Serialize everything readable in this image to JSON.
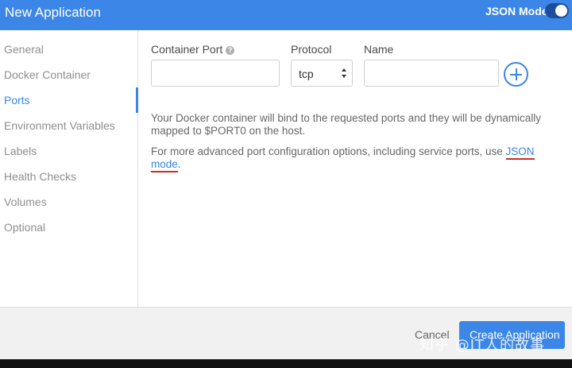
{
  "header": {
    "title": "New Application",
    "json_mode_label": "JSON Mode",
    "json_mode_on": true
  },
  "sidebar": {
    "items": [
      {
        "label": "General"
      },
      {
        "label": "Docker Container"
      },
      {
        "label": "Ports",
        "active": true
      },
      {
        "label": "Environment Variables"
      },
      {
        "label": "Labels"
      },
      {
        "label": "Health Checks"
      },
      {
        "label": "Volumes"
      },
      {
        "label": "Optional"
      }
    ]
  },
  "ports": {
    "container_port_label": "Container Port",
    "container_port_value": "",
    "protocol_label": "Protocol",
    "protocol_value": "tcp",
    "name_label": "Name",
    "name_value": ""
  },
  "help": {
    "line1": "Your Docker container will bind to the requested ports and they will be dynamically mapped to $PORT0 on the host.",
    "line2_prefix": "For more advanced port configuration options, including service ports, use ",
    "line2_link": "JSON mode",
    "line2_suffix": "."
  },
  "footer": {
    "cancel_label": "Cancel",
    "create_label": "Create Application"
  },
  "watermark": "知乎 @IT人的故事",
  "colors": {
    "accent": "#3b86e6",
    "annotation_underline": "#c6302a"
  }
}
